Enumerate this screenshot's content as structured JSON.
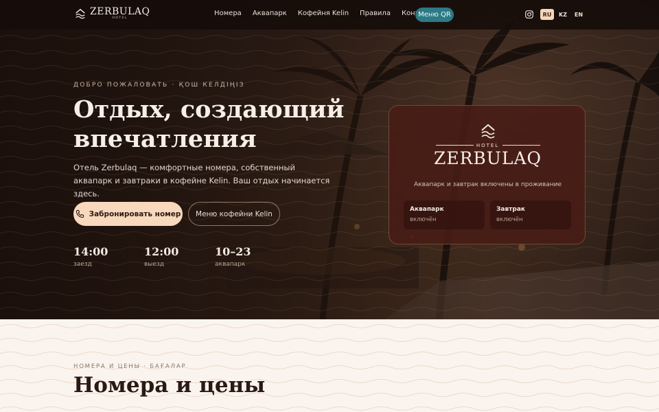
{
  "nav": {
    "logo": {
      "word": "ZERBULAQ",
      "sub": "HOTEL"
    },
    "items": [
      "Номера",
      "Аквапарк",
      "Кофейня Kelin",
      "Правила",
      "Контакты"
    ],
    "menu_qr": "Меню QR",
    "languages": [
      "RU",
      "KZ",
      "EN"
    ],
    "active_language": "RU"
  },
  "hero": {
    "eyebrow": "ДОБРО ПОЖАЛОВАТЬ · ҚОШ КЕЛДІҢІЗ",
    "headline": "Отдых, создающий впечатления",
    "lead": "Отель Zerbulaq — комфортные номера, собственный аквапарк и завтраки в кофейне Kelin. Ваш отдых начинается здесь.",
    "primary_button": "Забронировать номер",
    "secondary_button": "Меню кофейни Kelin",
    "stats": [
      {
        "value": "14:00",
        "label": "заезд"
      },
      {
        "value": "12:00",
        "label": "выезд"
      },
      {
        "value": "10–23",
        "label": "аквапарк"
      }
    ]
  },
  "card": {
    "hotel": "HOTEL",
    "brand": "ZERBULAQ",
    "tagline": "Аквапарк и завтрак включены в проживание",
    "features": [
      {
        "title": "Аквапарк",
        "status": "включён"
      },
      {
        "title": "Завтрак",
        "status": "включён"
      }
    ]
  },
  "rooms": {
    "eyebrow": "НОМЕРА И ЦЕНЫ · БАҒАЛАР",
    "title": "Номера и цены"
  },
  "colors": {
    "accent_peach": "#f8d9be",
    "accent_teal": "#2c7a86",
    "card_bg": "#481c16",
    "section_bg": "#fbf4ee"
  },
  "icons": [
    "hotel-logo-icon",
    "instagram-icon",
    "phone-icon"
  ]
}
